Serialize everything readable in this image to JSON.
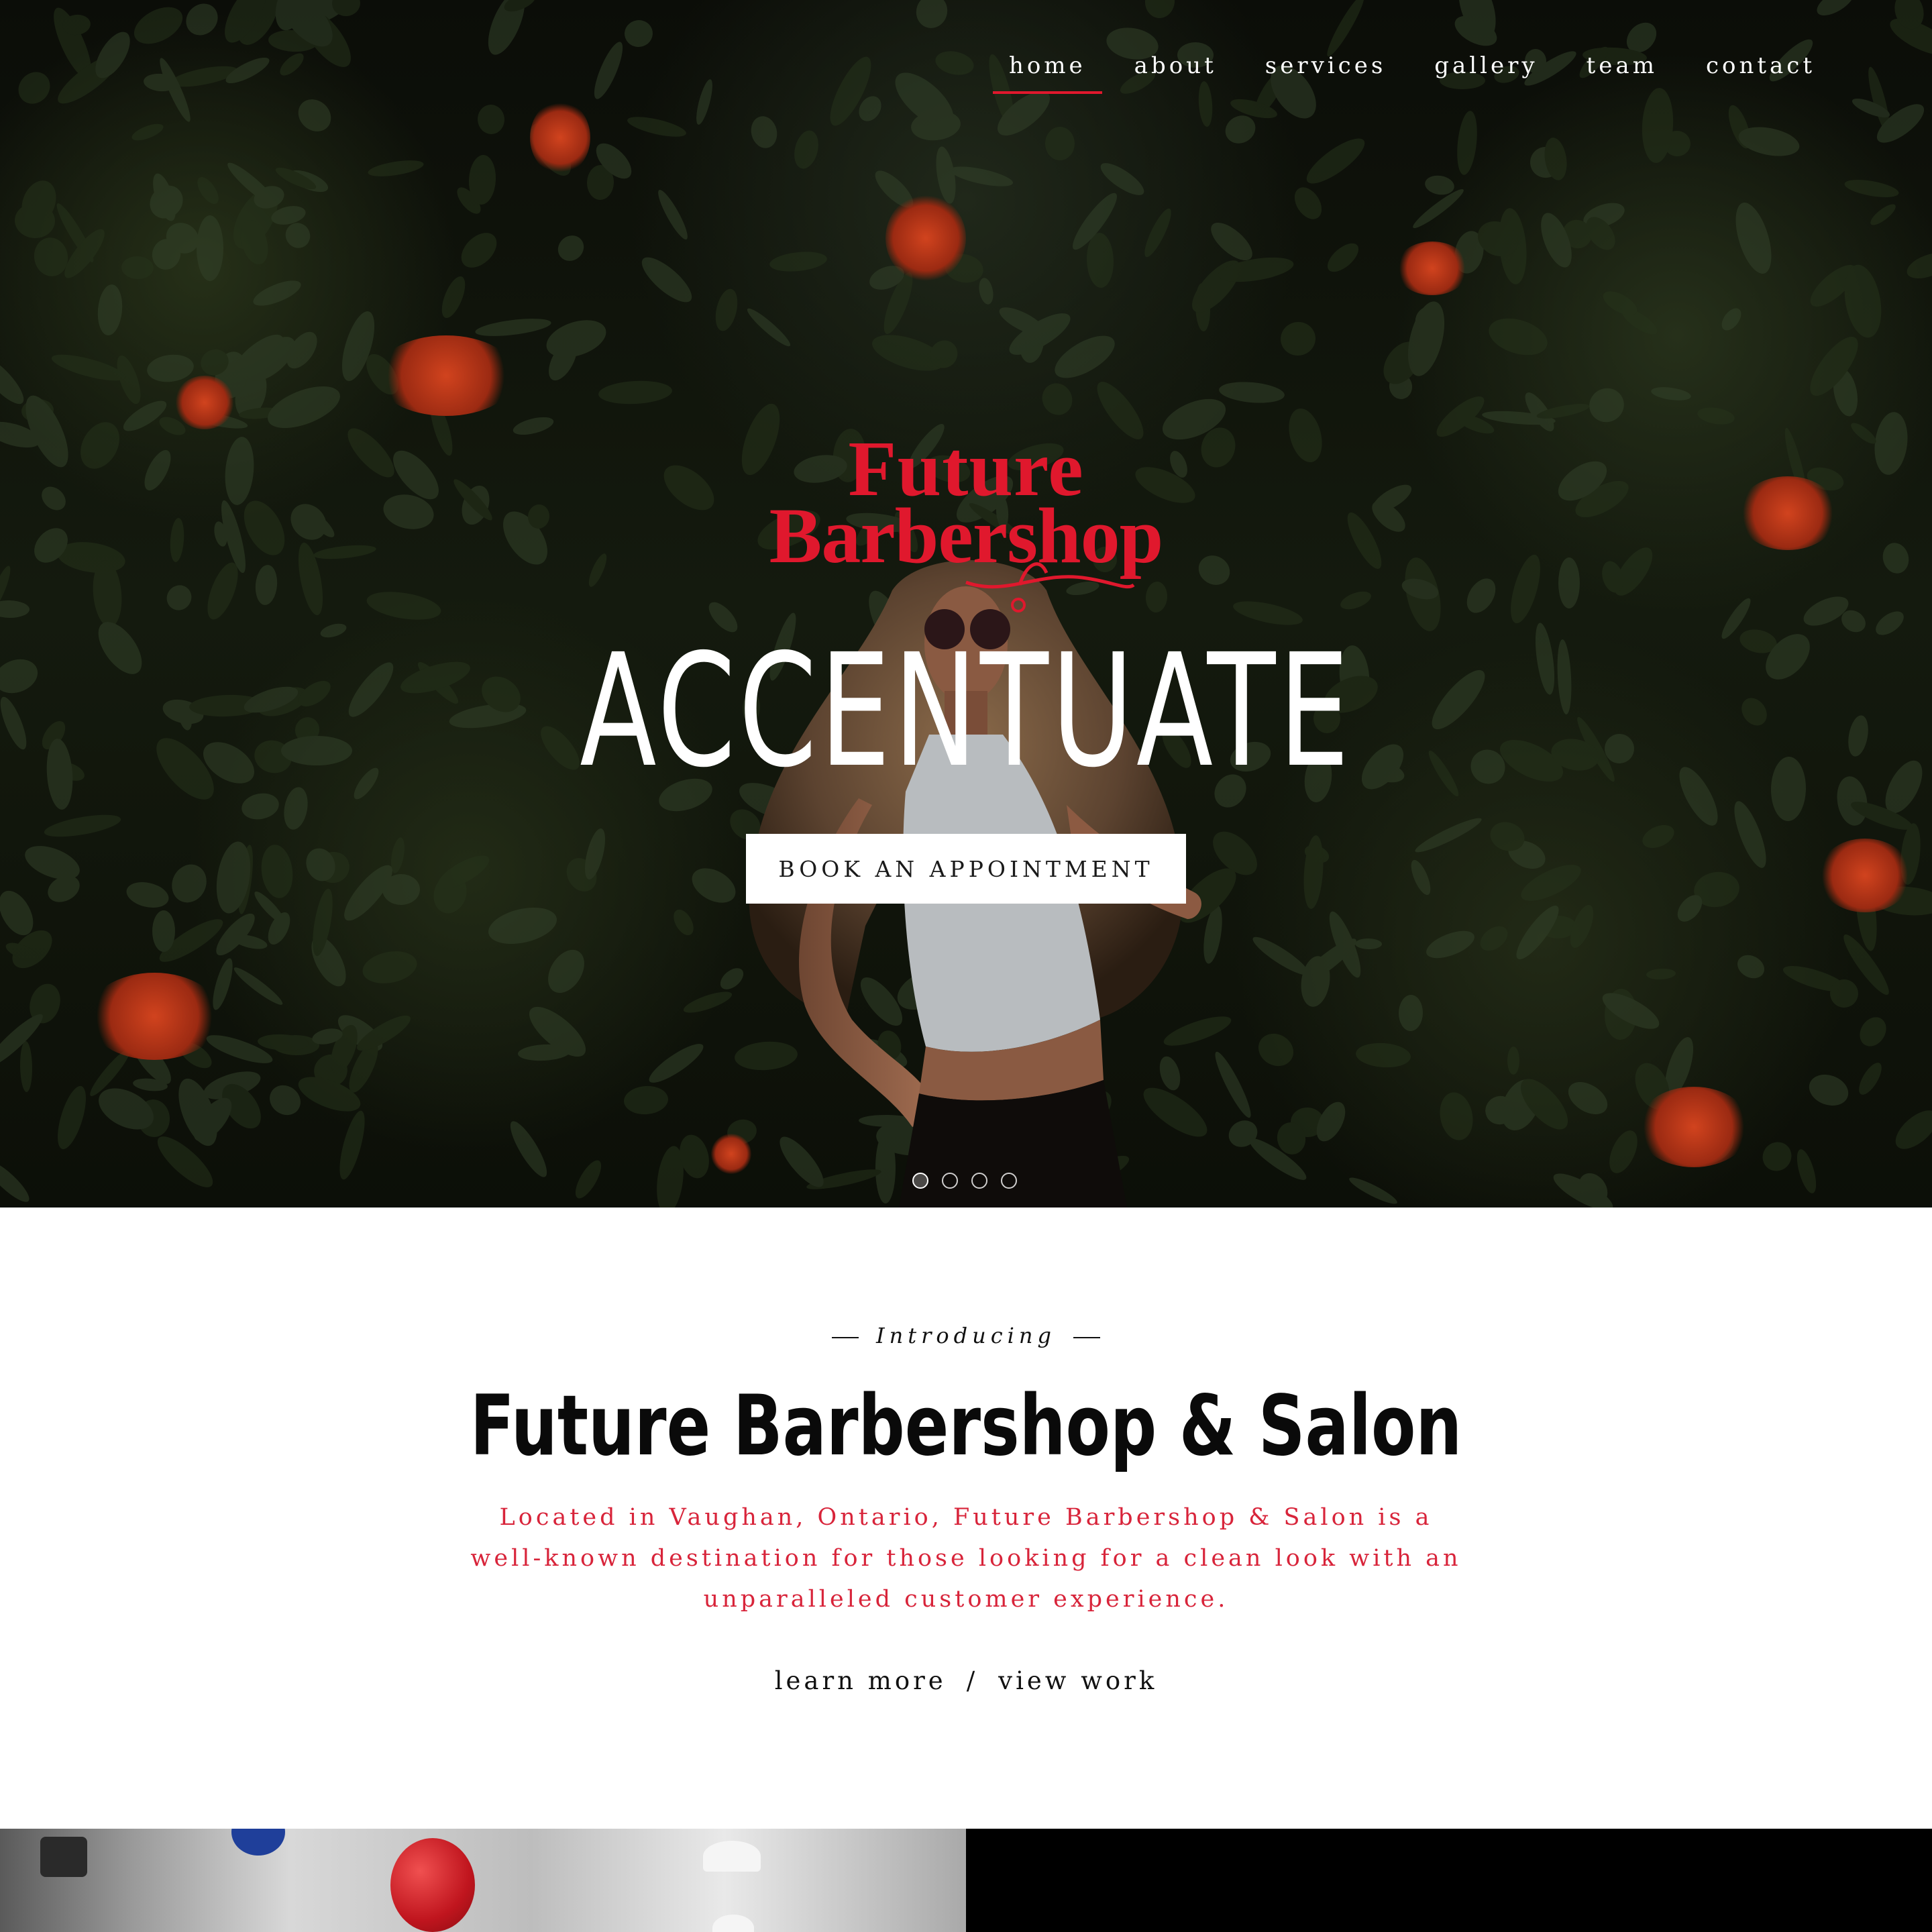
{
  "nav": {
    "items": [
      {
        "label": "home",
        "active": true
      },
      {
        "label": "about",
        "active": false
      },
      {
        "label": "services",
        "active": false
      },
      {
        "label": "gallery",
        "active": false
      },
      {
        "label": "team",
        "active": false
      },
      {
        "label": "contact",
        "active": false
      }
    ]
  },
  "hero": {
    "logo_line1": "Future",
    "logo_line2": "Barbershop",
    "headline": "ACCENTUATE",
    "cta_label": "BOOK AN APPOINTMENT",
    "slide_count": 4,
    "active_slide": 1
  },
  "intro": {
    "eyebrow": "Introducing",
    "title": "Future Barbershop & Salon",
    "description": "Located in Vaughan, Ontario, Future Barbershop & Salon is a well-known destination for those looking for a clean look with an unparalleled customer experience.",
    "link_learn_more": "learn more",
    "link_separator": "/",
    "link_view_work": "view work"
  },
  "colors": {
    "accent": "#e0182d",
    "description_text": "#d8243a",
    "hero_text": "#ffffff",
    "dark": "#000000"
  }
}
